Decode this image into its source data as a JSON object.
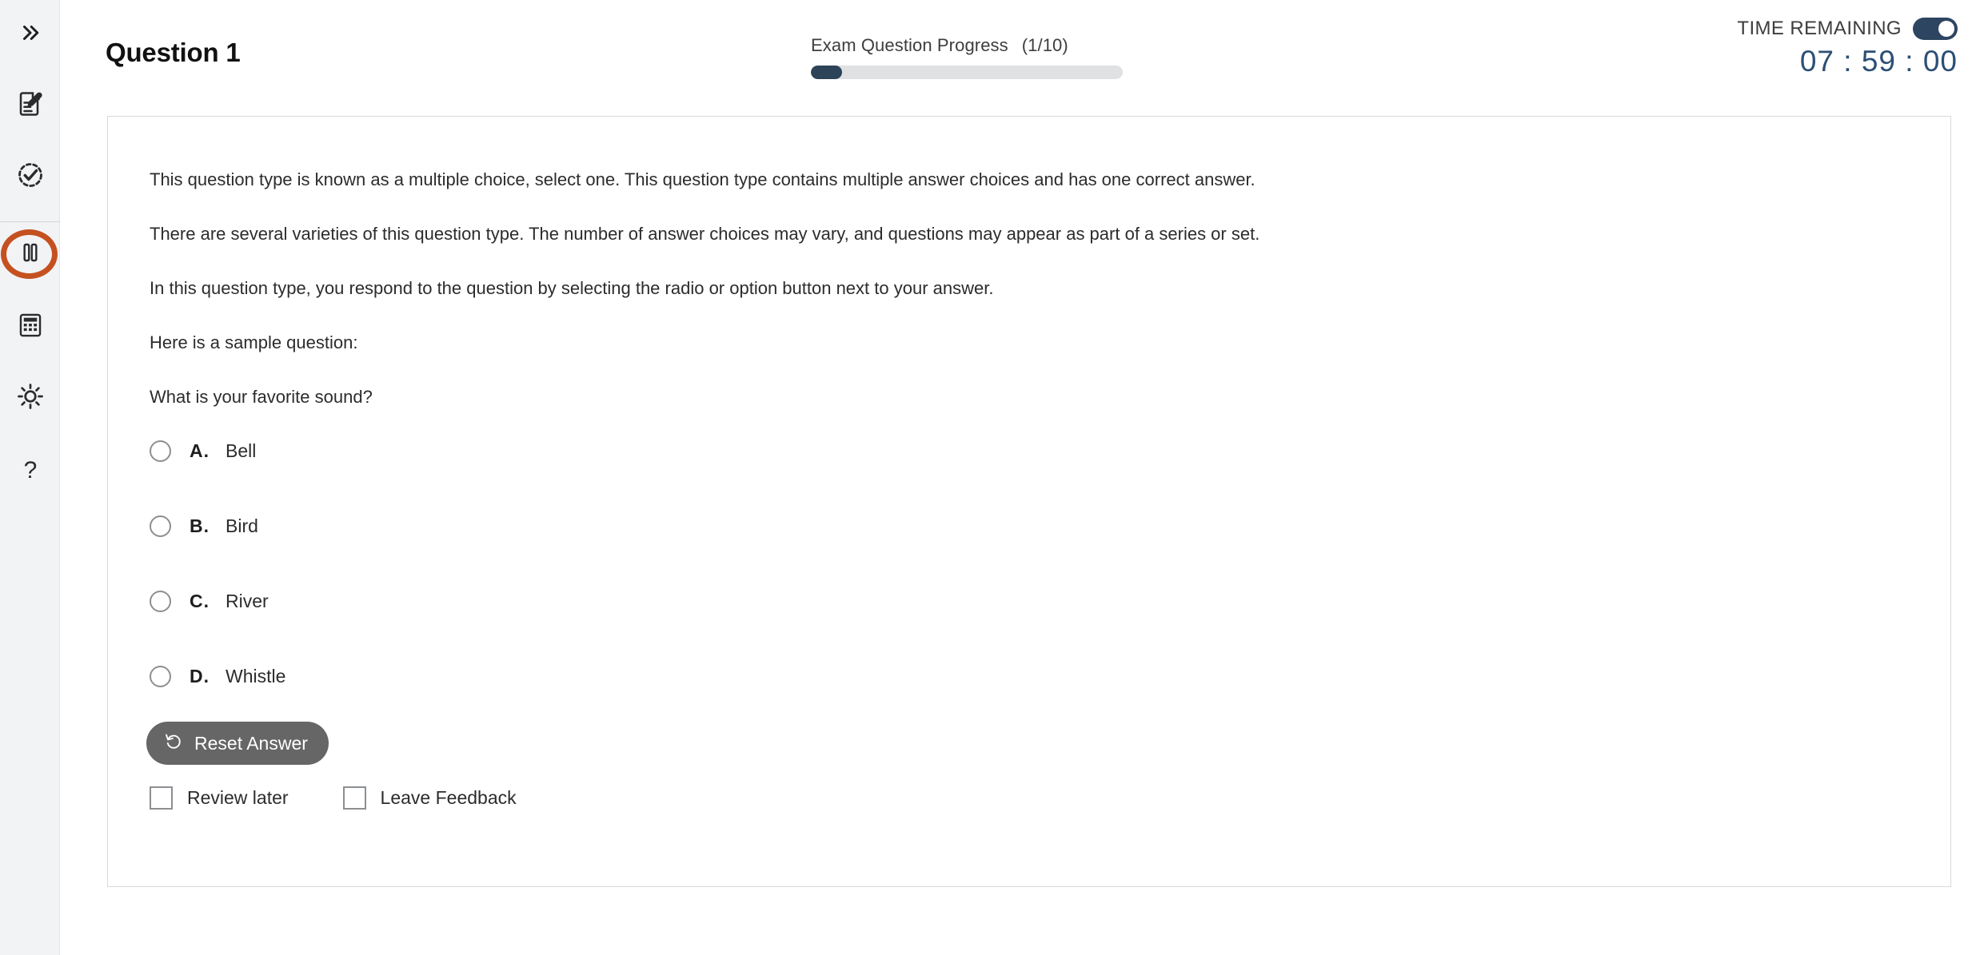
{
  "sidebar": {
    "items": [
      {
        "name": "expand-sidebar",
        "icon": "double-chevron-right-icon"
      },
      {
        "name": "notes",
        "icon": "note-pencil-icon"
      },
      {
        "name": "review-status",
        "icon": "dashed-circle-check-icon"
      },
      {
        "name": "pause-exam",
        "icon": "pause-icon",
        "highlighted": true
      },
      {
        "name": "calculator",
        "icon": "calculator-icon"
      },
      {
        "name": "brightness",
        "icon": "sun-icon"
      },
      {
        "name": "help",
        "icon": "question-mark-icon"
      }
    ]
  },
  "header": {
    "title": "Question 1",
    "progress": {
      "label": "Exam Question Progress",
      "count": "(1/10)",
      "percent": 10
    },
    "timer": {
      "label": "TIME REMAINING",
      "value": "07 : 59 : 00",
      "toggle_on": true
    }
  },
  "question": {
    "paragraphs": [
      "This question type is known as a multiple choice, select one. This question type contains multiple answer choices and has one correct answer.",
      "There are several varieties of this question type. The number of answer choices may vary, and questions may appear as part of a series or set.",
      "In this question type, you respond to the question by selecting the radio or option button next to your answer.",
      "Here is a sample question:",
      "What is your favorite sound?"
    ],
    "options": [
      {
        "letter": "A.",
        "text": "Bell",
        "selected": false
      },
      {
        "letter": "B.",
        "text": "Bird",
        "selected": false
      },
      {
        "letter": "C.",
        "text": "River",
        "selected": false
      },
      {
        "letter": "D.",
        "text": "Whistle",
        "selected": false
      }
    ],
    "reset_label": "Reset Answer",
    "checkboxes": [
      {
        "label": "Review later",
        "checked": false
      },
      {
        "label": "Leave Feedback",
        "checked": false
      }
    ]
  },
  "colors": {
    "accent_navy": "#2c4358",
    "highlight_orange": "#c4511f",
    "button_gray": "#666666",
    "sidebar_bg": "#f2f3f5"
  }
}
